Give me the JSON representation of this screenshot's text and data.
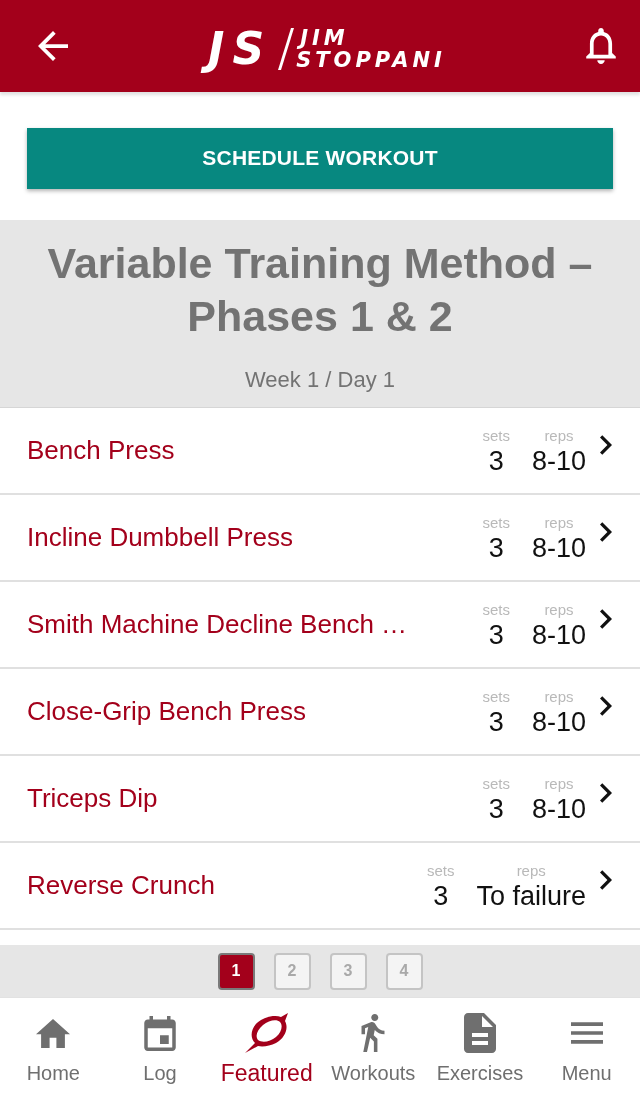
{
  "header": {
    "logo": {
      "initials": "JS",
      "first_name": "JIM",
      "last_name": "STOPPANI"
    }
  },
  "schedule_button": "SCHEDULE WORKOUT",
  "workout": {
    "title": "Variable Training Method – Phases 1 & 2",
    "subtitle": "Week 1 / Day 1"
  },
  "exercises": [
    {
      "name": "Bench Press",
      "sets_label": "sets",
      "sets": "3",
      "reps_label": "reps",
      "reps": "8-10"
    },
    {
      "name": "Incline Dumbbell Press",
      "sets_label": "sets",
      "sets": "3",
      "reps_label": "reps",
      "reps": "8-10"
    },
    {
      "name": "Smith Machine Decline Bench …",
      "sets_label": "sets",
      "sets": "3",
      "reps_label": "reps",
      "reps": "8-10"
    },
    {
      "name": "Close-Grip Bench Press",
      "sets_label": "sets",
      "sets": "3",
      "reps_label": "reps",
      "reps": "8-10"
    },
    {
      "name": "Triceps Dip",
      "sets_label": "sets",
      "sets": "3",
      "reps_label": "reps",
      "reps": "8-10"
    },
    {
      "name": "Reverse Crunch",
      "sets_label": "sets",
      "sets": "3",
      "reps_label": "reps",
      "reps": "To failure"
    }
  ],
  "pagination": [
    {
      "label": "1",
      "selected": true
    },
    {
      "label": "2",
      "selected": false
    },
    {
      "label": "3",
      "selected": false
    },
    {
      "label": "4",
      "selected": false
    }
  ],
  "bottom_nav": [
    {
      "kind": "home",
      "label": "Home",
      "selected": false
    },
    {
      "kind": "log",
      "label": "Log",
      "selected": false
    },
    {
      "kind": "featured",
      "label": "Featured",
      "selected": true
    },
    {
      "kind": "workouts",
      "label": "Workouts",
      "selected": false
    },
    {
      "kind": "exercises",
      "label": "Exercises",
      "selected": false
    },
    {
      "kind": "menu",
      "label": "Menu",
      "selected": false
    }
  ]
}
